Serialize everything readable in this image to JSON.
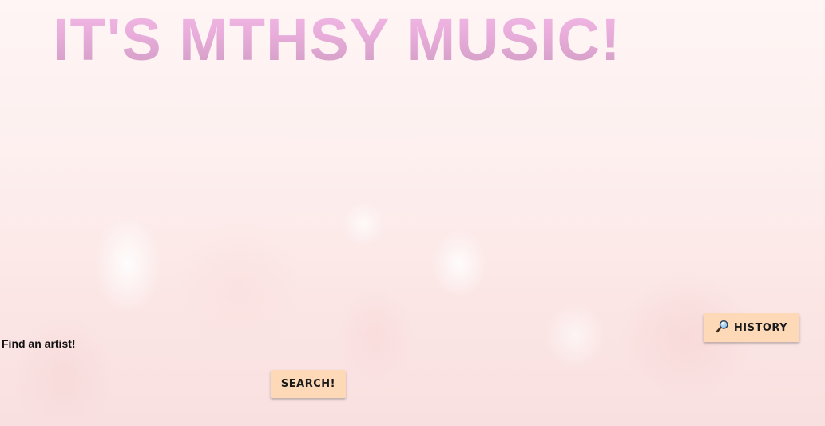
{
  "header": {
    "title": "IT'S MTHSY MUSIC!"
  },
  "toolbar": {
    "history_label": "HISTORY",
    "history_icon": "magnifier-icon"
  },
  "search": {
    "label": "Find an artist!",
    "value": "",
    "placeholder": "",
    "button_label": "SEARCH!"
  },
  "colors": {
    "title_gradient_top": "#f3b9e6",
    "title_gradient_bottom": "#cf9cc3",
    "button_bg": "#fdd9b8",
    "background": "#fdf0ef"
  }
}
